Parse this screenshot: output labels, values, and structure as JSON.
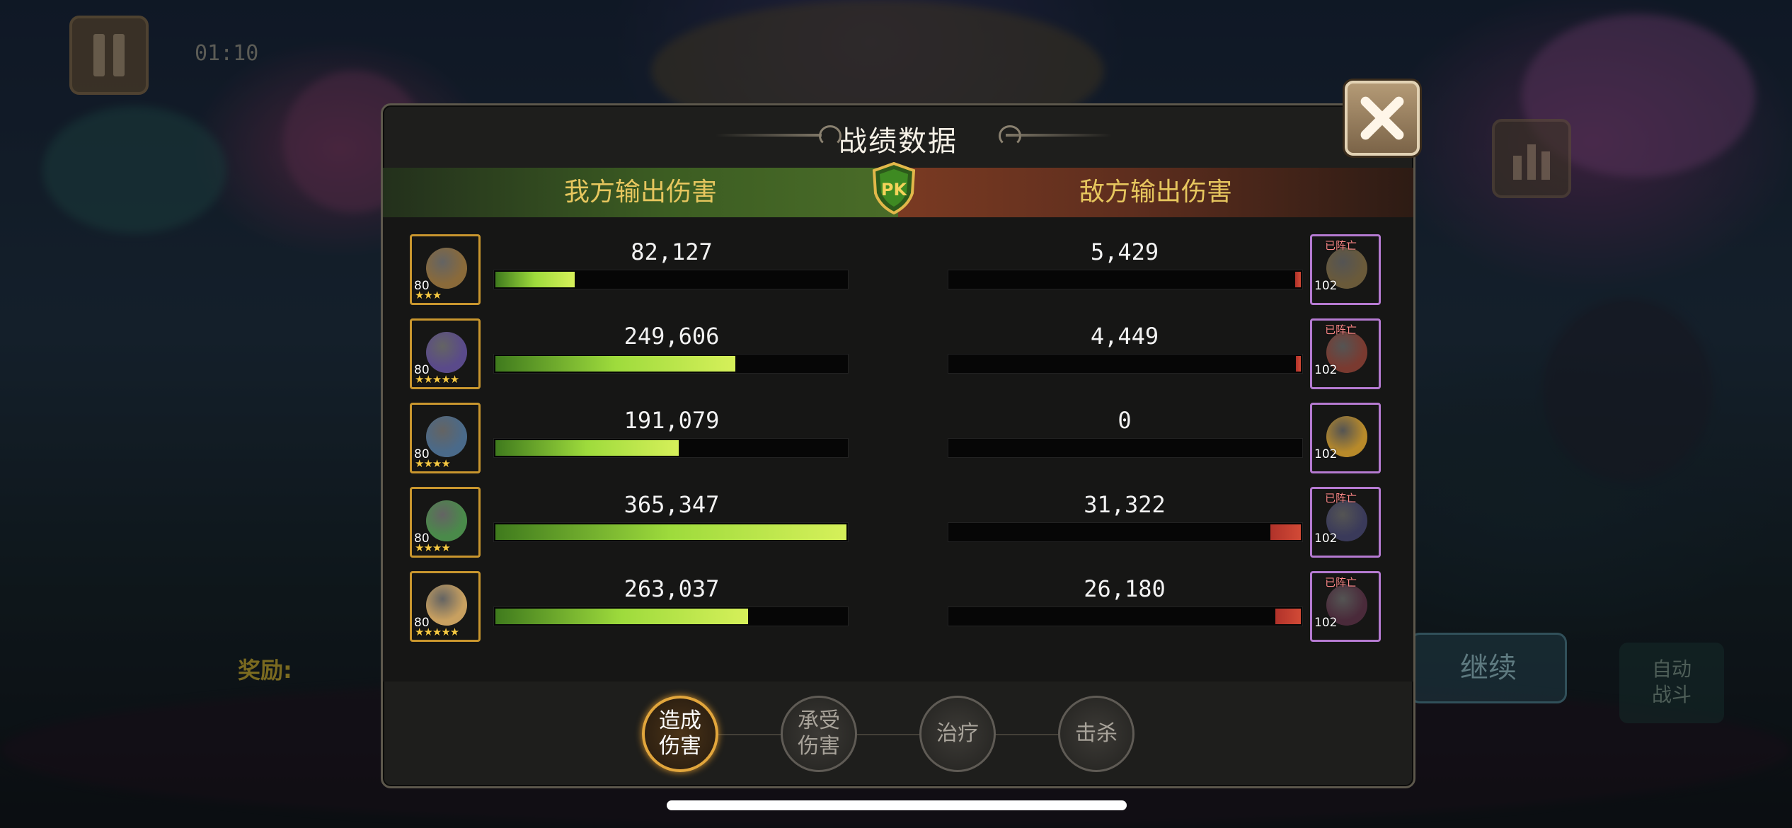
{
  "background": {
    "timer": "01:10",
    "continue_label": "继续",
    "auto_label_line1": "自动",
    "auto_label_line2": "战斗",
    "reward_label": "奖励:"
  },
  "panel": {
    "title": "战绩数据",
    "ally_header": "我方输出伤害",
    "enemy_header": "敌方输出伤害",
    "pk_badge": "PK",
    "close_icon": "close-x-icon"
  },
  "colors": {
    "ally_bar": "#9edb3c",
    "enemy_bar": "#d24a36",
    "ally_frame": "#c9962e",
    "enemy_frame": "#b57ad1",
    "header_text": "#e6c65e"
  },
  "rows": [
    {
      "ally": {
        "level": "80",
        "stars": "★★★",
        "value": "82,127",
        "fraction": 0.225,
        "portrait": "#8a6a3a"
      },
      "enemy": {
        "level": "102",
        "status": "已阵亡",
        "value": "5,429",
        "fraction": 0.017,
        "portrait": "#6a5a3a"
      }
    },
    {
      "ally": {
        "level": "80",
        "stars": "★★★★★",
        "value": "249,606",
        "fraction": 0.683,
        "portrait": "#5a4a8a"
      },
      "enemy": {
        "level": "102",
        "status": "已阵亡",
        "value": "4,449",
        "fraction": 0.014,
        "portrait": "#7a3a30"
      }
    },
    {
      "ally": {
        "level": "80",
        "stars": "★★★★",
        "value": "191,079",
        "fraction": 0.523,
        "portrait": "#4a6a8a"
      },
      "enemy": {
        "level": "102",
        "status": "",
        "value": "0",
        "fraction": 0.0,
        "portrait": "#b88a2a"
      }
    },
    {
      "ally": {
        "level": "80",
        "stars": "★★★★",
        "value": "365,347",
        "fraction": 1.0,
        "portrait": "#4a8a4a"
      },
      "enemy": {
        "level": "102",
        "status": "已阵亡",
        "value": "31,322",
        "fraction": 0.086,
        "portrait": "#3a3a5a"
      }
    },
    {
      "ally": {
        "level": "80",
        "stars": "★★★★★",
        "value": "263,037",
        "fraction": 0.72,
        "portrait": "#c8a060"
      },
      "enemy": {
        "level": "102",
        "status": "已阵亡",
        "value": "26,180",
        "fraction": 0.072,
        "portrait": "#4a2a3a"
      }
    }
  ],
  "categories": [
    {
      "line1": "造成",
      "line2": "伤害",
      "active": true
    },
    {
      "line1": "承受",
      "line2": "伤害",
      "active": false
    },
    {
      "line1": "治疗",
      "line2": "",
      "active": false
    },
    {
      "line1": "击杀",
      "line2": "",
      "active": false
    }
  ]
}
